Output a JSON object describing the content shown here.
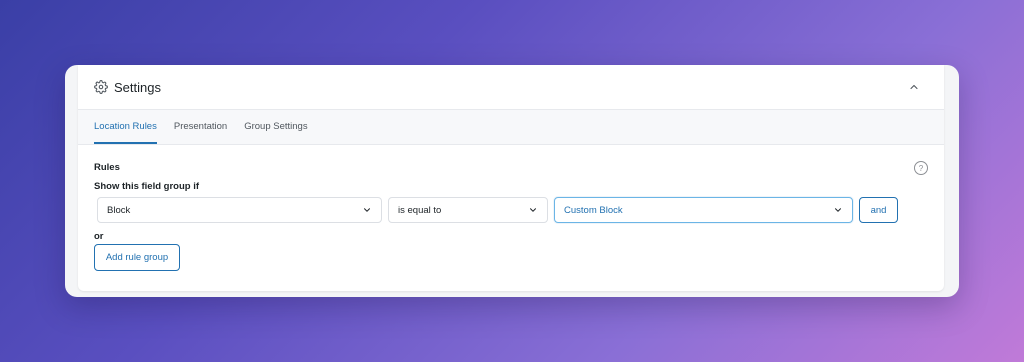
{
  "settings": {
    "title": "Settings",
    "header_icon": "gear-icon",
    "collapse_icon": "chevron-up-icon"
  },
  "tabs": [
    {
      "label": "Location Rules",
      "active": true
    },
    {
      "label": "Presentation",
      "active": false
    },
    {
      "label": "Group Settings",
      "active": false
    }
  ],
  "rules": {
    "label": "Rules",
    "help_icon_glyph": "?",
    "show_if_label": "Show this field group if",
    "param_select": "Block",
    "operator_select": "is equal to",
    "value_select": "Custom Block",
    "and_button": "and",
    "or_label": "or",
    "add_group_button": "Add rule group"
  },
  "colors": {
    "accent": "#2271b1",
    "focus_border": "#6bb5e6"
  }
}
